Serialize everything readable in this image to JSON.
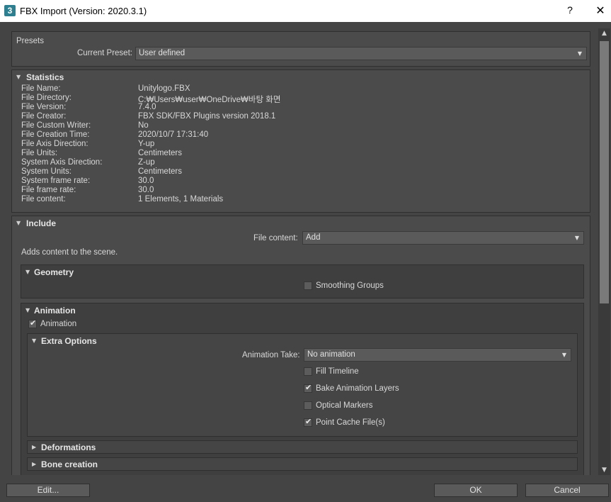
{
  "window": {
    "title": "FBX Import (Version: 2020.3.1)",
    "icon_label": "3",
    "help": "?",
    "close": "✕"
  },
  "presets": {
    "label": "Presets",
    "current_label": "Current Preset:",
    "current_value": "User defined"
  },
  "statistics": {
    "title": "Statistics",
    "rows": [
      {
        "k": "File Name:",
        "v": "Unitylogo.FBX"
      },
      {
        "k": "File Directory:",
        "v": "C:₩Users₩user₩OneDrive₩바탕 화면"
      },
      {
        "k": "File Version:",
        "v": "7.4.0"
      },
      {
        "k": "File Creator:",
        "v": "FBX SDK/FBX Plugins version 2018.1"
      },
      {
        "k": "File Custom Writer:",
        "v": "No"
      },
      {
        "k": "File Creation Time:",
        "v": "2020/10/7  17:31:40"
      },
      {
        "k": "File Axis Direction:",
        "v": "Y-up"
      },
      {
        "k": "File Units:",
        "v": "Centimeters"
      },
      {
        "k": "System Axis Direction:",
        "v": "Z-up"
      },
      {
        "k": "System Units:",
        "v": "Centimeters"
      },
      {
        "k": "System frame rate:",
        "v": "30.0"
      },
      {
        "k": "File frame rate:",
        "v": "30.0"
      },
      {
        "k": "File content:",
        "v": "1 Elements,    1 Materials"
      }
    ]
  },
  "include": {
    "title": "Include",
    "file_content_label": "File content:",
    "file_content_value": "Add",
    "description": "Adds content to the scene."
  },
  "geometry": {
    "title": "Geometry",
    "smoothing_groups": "Smoothing Groups"
  },
  "animation": {
    "title": "Animation",
    "checkbox": "Animation",
    "extra_title": "Extra Options",
    "take_label": "Animation Take:",
    "take_value": "No animation",
    "fill_timeline": "Fill Timeline",
    "bake_layers": "Bake Animation Layers",
    "optical_markers": "Optical Markers",
    "point_cache": "Point Cache File(s)"
  },
  "deformations": {
    "title": "Deformations"
  },
  "bone_creation": {
    "title": "Bone creation"
  },
  "footer": {
    "edit": "Edit...",
    "ok": "OK",
    "cancel": "Cancel"
  }
}
